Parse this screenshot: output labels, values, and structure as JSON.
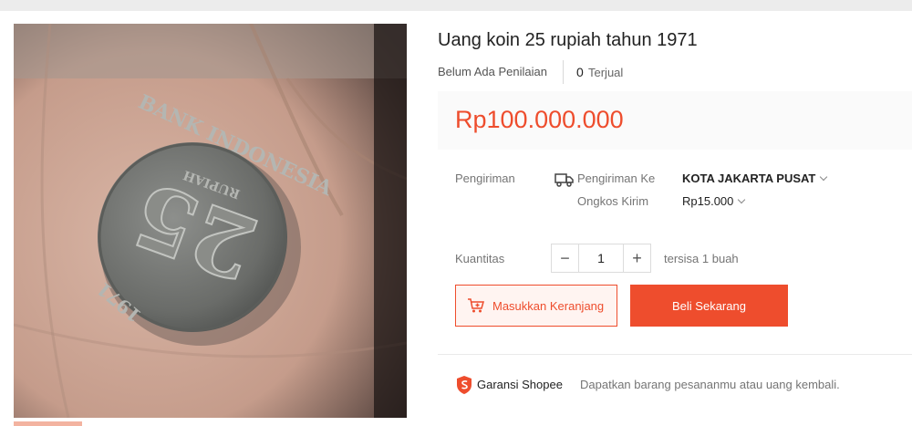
{
  "product": {
    "title": "Uang koin 25 rupiah tahun 1971",
    "rating_text": "Belum Ada Penilaian",
    "sold_count": "0",
    "sold_label": "Terjual",
    "price": "Rp100.000.000",
    "image": {
      "coin_top_text": "BANK INDONESIA",
      "coin_denomination": "25",
      "coin_word": "RUPIAH",
      "coin_year": "1971"
    }
  },
  "shipping": {
    "label": "Pengiriman",
    "to_label": "Pengiriman Ke",
    "to_value": "KOTA JAKARTA PUSAT",
    "cost_label": "Ongkos Kirim",
    "cost_value": "Rp15.000",
    "icon": "truck-icon"
  },
  "quantity": {
    "label": "Kuantitas",
    "minus": "−",
    "value": "1",
    "plus": "+",
    "stock_text": "tersisa 1 buah"
  },
  "actions": {
    "add_to_cart": "Masukkan Keranjang",
    "buy_now": "Beli Sekarang"
  },
  "guarantee": {
    "title": "Garansi Shopee",
    "description": "Dapatkan barang pesananmu atau uang kembali.",
    "icon": "shield-icon"
  },
  "colors": {
    "accent": "#ee4d2d",
    "price_bg": "#fafafa"
  }
}
